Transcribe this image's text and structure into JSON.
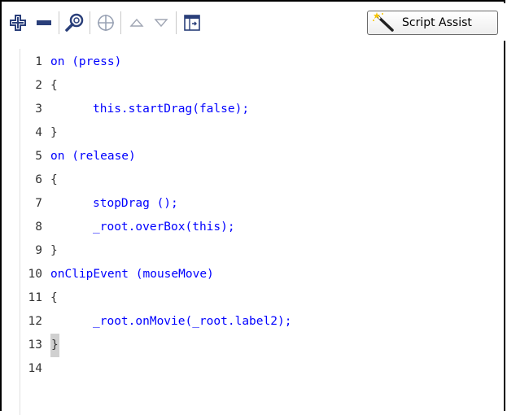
{
  "toolbar": {
    "buttons": [
      {
        "name": "add-statement-icon"
      },
      {
        "name": "delete-statement-icon"
      },
      {
        "name": "find-icon"
      },
      {
        "name": "insert-target-path-icon"
      },
      {
        "name": "move-up-icon"
      },
      {
        "name": "move-down-icon"
      },
      {
        "name": "show-hide-toolbox-icon"
      }
    ],
    "script_assist_label": "Script Assist",
    "script_assist_icon": "magic-wand-icon"
  },
  "editor": {
    "lines": [
      {
        "num": "1",
        "text": "on (press)"
      },
      {
        "num": "2",
        "text": "{"
      },
      {
        "num": "3",
        "text": "this.startDrag(false);"
      },
      {
        "num": "4",
        "text": "}"
      },
      {
        "num": "5",
        "text": "on (release)"
      },
      {
        "num": "6",
        "text": "{"
      },
      {
        "num": "7",
        "text": "stopDrag ();"
      },
      {
        "num": "8",
        "text": "_root.overBox(this);"
      },
      {
        "num": "9",
        "text": "}"
      },
      {
        "num": "10",
        "text": "onClipEvent (mouseMove)"
      },
      {
        "num": "11",
        "text": "{"
      },
      {
        "num": "12",
        "text": "_root.onMovie(_root.label2);"
      },
      {
        "num": "13",
        "text": "}"
      },
      {
        "num": "14",
        "text": ""
      }
    ]
  },
  "colors": {
    "keyword": "#0000ff",
    "plain": "#333333",
    "highlight": "#d0d0d0"
  }
}
